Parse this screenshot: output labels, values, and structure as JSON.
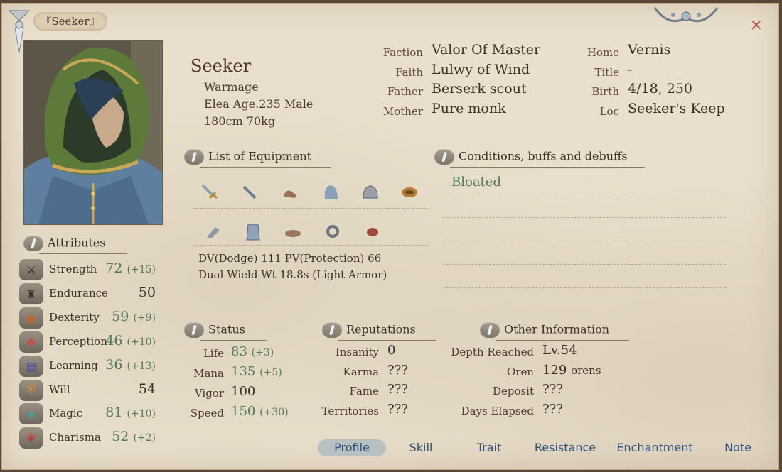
{
  "window": {
    "title": "『Seeker』",
    "close_label": "×"
  },
  "profile": {
    "name": "Seeker",
    "class": "Warmage",
    "race_age_sex": "Elea Age.235 Male",
    "height_weight": "180cm 70kg"
  },
  "info_mid": [
    {
      "label": "Faction",
      "value": "Valor Of Master"
    },
    {
      "label": "Faith",
      "value": "Lulwy of Wind"
    },
    {
      "label": "Father",
      "value": "Berserk scout"
    },
    {
      "label": "Mother",
      "value": "Pure monk"
    }
  ],
  "info_right": [
    {
      "label": "Home",
      "value": "Vernis"
    },
    {
      "label": "Title",
      "value": "-"
    },
    {
      "label": "Birth",
      "value": "4/18, 250"
    },
    {
      "label": "Loc",
      "value": "Seeker's Keep"
    }
  ],
  "equipment": {
    "header": "List of Equipment",
    "slots_row1": [
      "sword-icon",
      "rod-icon",
      "glove-icon",
      "cloak-icon",
      "helmet-icon",
      "belt-icon"
    ],
    "slots_row2": [
      "boots-icon",
      "armor-icon",
      "hat-icon",
      "ring-icon",
      "amulet-icon"
    ],
    "dv_pv": "DV(Dodge) 111   PV(Protection) 66",
    "wield_info": "Dual Wield Wt 18.8s (Light Armor)"
  },
  "conditions": {
    "header": "Conditions, buffs and debuffs",
    "items": [
      "Bloated"
    ]
  },
  "attributes": {
    "header": "Attributes",
    "items": [
      {
        "label": "Strength",
        "value": "72",
        "bonus": "(+15)",
        "icon": "strength-icon"
      },
      {
        "label": "Endurance",
        "value": "50",
        "bonus": "",
        "icon": "endurance-icon"
      },
      {
        "label": "Dexterity",
        "value": "59",
        "bonus": "(+9)",
        "icon": "dexterity-icon"
      },
      {
        "label": "Perception",
        "value": "46",
        "bonus": "(+10)",
        "icon": "perception-icon"
      },
      {
        "label": "Learning",
        "value": "36",
        "bonus": "(+13)",
        "icon": "learning-icon"
      },
      {
        "label": "Will",
        "value": "54",
        "bonus": "",
        "icon": "will-icon"
      },
      {
        "label": "Magic",
        "value": "81",
        "bonus": "(+10)",
        "icon": "magic-icon"
      },
      {
        "label": "Charisma",
        "value": "52",
        "bonus": "(+2)",
        "icon": "charisma-icon"
      }
    ]
  },
  "status": {
    "header": "Status",
    "items": [
      {
        "label": "Life",
        "value": "83",
        "bonus": "(+3)"
      },
      {
        "label": "Mana",
        "value": "135",
        "bonus": "(+5)"
      },
      {
        "label": "Vigor",
        "value": "100",
        "bonus": ""
      },
      {
        "label": "Speed",
        "value": "150",
        "bonus": "(+30)"
      }
    ]
  },
  "reputations": {
    "header": "Reputations",
    "items": [
      {
        "label": "Insanity",
        "value": "0"
      },
      {
        "label": "Karma",
        "value": "???"
      },
      {
        "label": "Fame",
        "value": "???"
      },
      {
        "label": "Territories",
        "value": "???"
      }
    ]
  },
  "other_info": {
    "header": "Other Information",
    "items": [
      {
        "label": "Depth Reached",
        "value": "Lv.54",
        "unit": ""
      },
      {
        "label": "Oren",
        "value": "129",
        "unit": "orens"
      },
      {
        "label": "Deposit",
        "value": "???",
        "unit": ""
      },
      {
        "label": "Days Elapsed",
        "value": "???",
        "unit": ""
      }
    ]
  },
  "tabs": [
    {
      "label": "Profile",
      "active": true
    },
    {
      "label": "Skill",
      "active": false
    },
    {
      "label": "Trait",
      "active": false
    },
    {
      "label": "Resistance",
      "active": false
    },
    {
      "label": "Enchantment",
      "active": false
    },
    {
      "label": "Note",
      "active": false
    }
  ],
  "colors": {
    "positive": "#4e7a55",
    "tab_text": "#2d4e78",
    "close": "#b24b4b"
  }
}
